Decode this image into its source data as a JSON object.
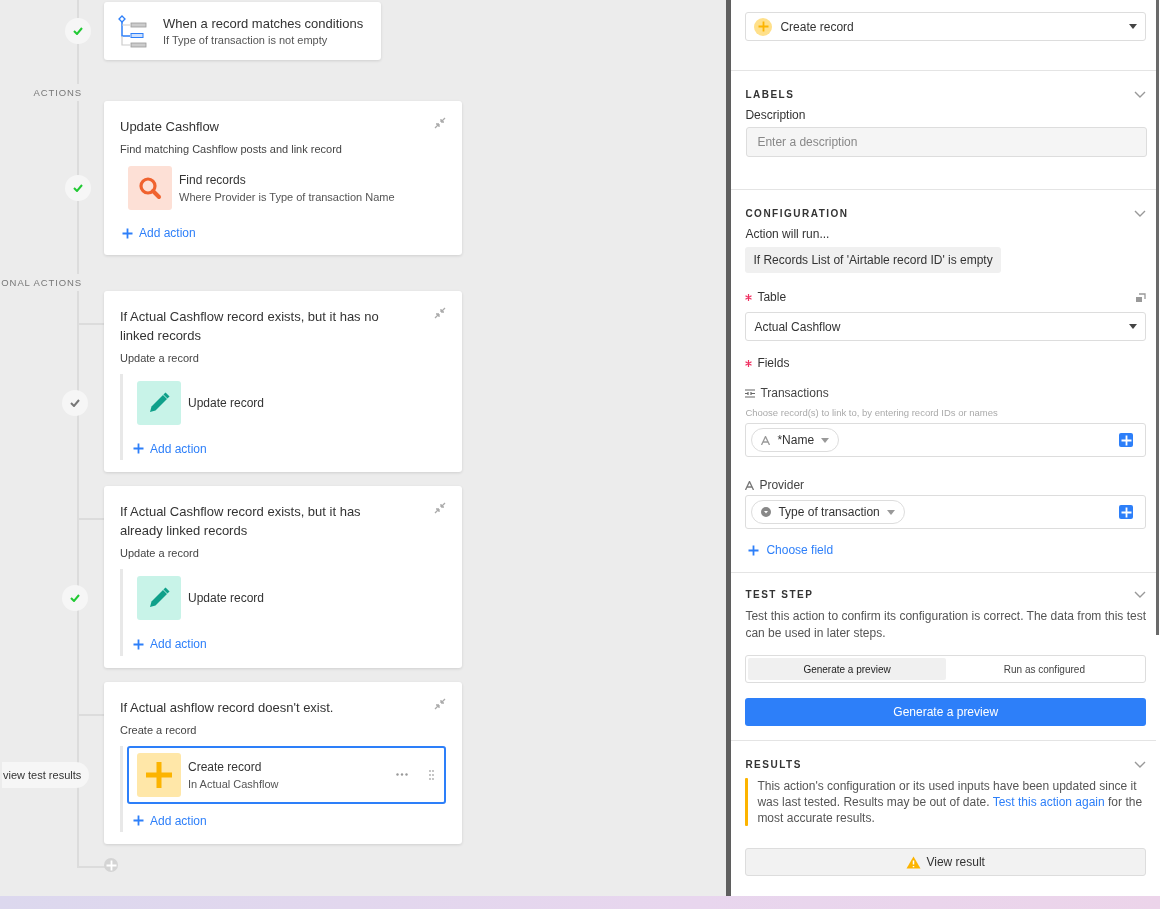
{
  "canvas": {
    "trigger": {
      "title": "When a record matches conditions",
      "subtitle": "If Type of transaction is not empty",
      "color": "#20c933"
    },
    "groups": [
      {
        "kind": "sequence",
        "section_label": "ACTIONS",
        "title": "Update Cashflow",
        "description": "Find matching Cashflow posts and link record",
        "color": "#20c933",
        "steps": [
          {
            "kind": "find",
            "title": "Find records",
            "subtitle": "Where Provider is Type of transaction Name",
            "selected": false
          }
        ],
        "add_label": "Add action"
      },
      {
        "kind": "conditional",
        "section_label": "ONAL ACTIONS",
        "title": "If Actual Cashflow record exists, but it has no linked records",
        "description": "Update a record",
        "color": "#777777",
        "steps": [
          {
            "kind": "update",
            "title": "Update record",
            "selected": false
          }
        ],
        "add_label": "Add action"
      },
      {
        "kind": "conditional",
        "title": "If Actual Cashflow record exists, but it has already linked records",
        "description": "Update a record",
        "color": "#20c933",
        "steps": [
          {
            "kind": "update",
            "title": "Update record",
            "selected": false
          }
        ],
        "add_label": "Add action"
      },
      {
        "kind": "conditional",
        "title": "If Actual ashflow record doesn't exist.",
        "description": "Create a record",
        "results_button": "view test results",
        "steps": [
          {
            "kind": "create",
            "title": "Create record",
            "subtitle": "In Actual Cashflow",
            "selected": true
          }
        ],
        "add_label": "Add action"
      }
    ]
  },
  "panel": {
    "action_type": {
      "value": "Create record"
    },
    "labels": {
      "title": "LABELS",
      "description_label": "Description",
      "description_placeholder": "Enter a description"
    },
    "configuration": {
      "title": "CONFIGURATION",
      "run_label": "Action will run...",
      "condition": "If Records List of 'Airtable record ID' is empty",
      "table_label": "Table",
      "table_required": true,
      "table_value": "Actual Cashflow",
      "fields_label": "Fields",
      "fields_required": true,
      "fields": [
        {
          "kind": "link",
          "name": "Transactions",
          "hint": "Choose record(s) to link to, by entering record IDs or names",
          "token": {
            "kind": "text",
            "label": "*Name"
          }
        },
        {
          "kind": "text",
          "name": "Provider",
          "token": {
            "kind": "select",
            "label": "Type of transaction"
          }
        }
      ],
      "choose_field": "Choose field"
    },
    "test_step": {
      "title": "TEST STEP",
      "description": "Test this action to confirm its configuration is correct. The data from this test can be used in later steps.",
      "modes": [
        {
          "label": "Generate a preview",
          "selected": true
        },
        {
          "label": "Run as configured",
          "selected": false
        }
      ],
      "button": "Generate a preview"
    },
    "results": {
      "title": "RESULTS",
      "warning_before": "This action's configuration or its used inputs have been updated since it was last tested. Results may be out of date. ",
      "warning_link": "Test this action again",
      "warning_after": " for the most accurate results.",
      "button": "View result"
    }
  }
}
